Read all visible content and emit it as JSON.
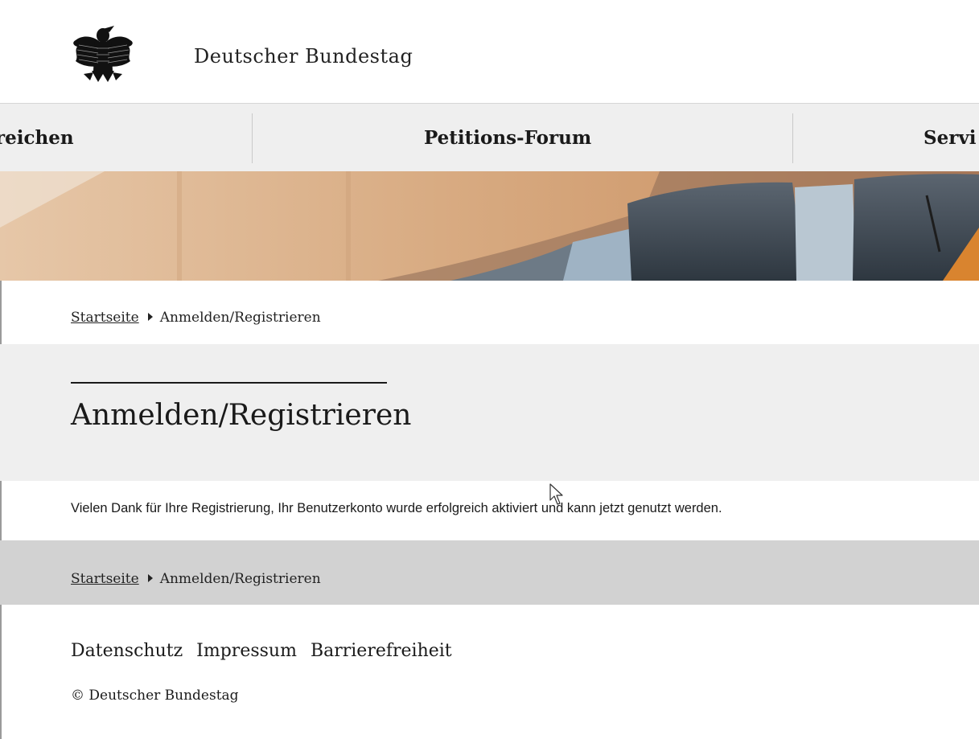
{
  "header": {
    "brand": "Deutscher Bundestag",
    "logo_icon": "federal-eagle-icon"
  },
  "nav": {
    "items": [
      {
        "label": "reichen"
      },
      {
        "label": "Petitions-Forum"
      },
      {
        "label": "Servi"
      }
    ]
  },
  "breadcrumb": {
    "home": "Startseite",
    "current": "Anmelden/Registrieren"
  },
  "main": {
    "title": "Anmelden/Registrieren",
    "message": "Vielen Dank für Ihre Registrierung, Ihr Benutzerkonto wurde erfolgreich aktiviert und kann jetzt genutzt werden."
  },
  "footer": {
    "links": [
      "Datenschutz",
      "Impressum",
      "Barrierefreiheit"
    ],
    "copyright": "© Deutscher Bundestag"
  },
  "colors": {
    "nav_bg": "#efefef",
    "title_band_bg": "#efefef",
    "crumb_band_bg": "#d2d2d2",
    "text": "#1a1a1a"
  }
}
